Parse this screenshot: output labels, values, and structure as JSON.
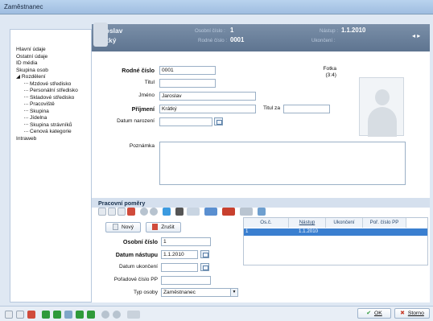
{
  "window": {
    "title": "Zaměstnanec"
  },
  "tree": {
    "items": [
      {
        "label": "Hlavní údaje",
        "child": false
      },
      {
        "label": "Ostatní údaje",
        "child": false
      },
      {
        "label": "ID média",
        "child": false
      },
      {
        "label": "Skupina osob",
        "child": false
      },
      {
        "label": "◢ Rozdělení",
        "child": false
      },
      {
        "label": "Mzdové středisko",
        "child": true
      },
      {
        "label": "Personální středisko",
        "child": true
      },
      {
        "label": "Skladové středisko",
        "child": true
      },
      {
        "label": "Pracoviště",
        "child": true
      },
      {
        "label": "Skupina",
        "child": true
      },
      {
        "label": "Jídelna",
        "child": true
      },
      {
        "label": "Skupina strávníků",
        "child": true
      },
      {
        "label": "Cenová kategorie",
        "child": true
      },
      {
        "label": "Intraweb",
        "child": false
      }
    ]
  },
  "header": {
    "first_name": "Jaroslav",
    "last_name": "Krátký",
    "osobni_cislo_label": "Osobní číslo :",
    "osobni_cislo": "1",
    "rodne_cislo_label": "Rodné číslo :",
    "rodne_cislo": "0001",
    "nastup_label": "Nástup :",
    "nastup": "1.1.2010",
    "ukonceni_label": "Ukončení :",
    "nav_icon": "play-arrow-icon"
  },
  "form": {
    "rodne_cislo_label": "Rodné číslo",
    "rodne_cislo_value": "0001",
    "titul_label": "Titul",
    "titul_value": "",
    "jmeno_label": "Jméno",
    "jmeno_value": "Jaroslav",
    "prijmeni_label": "Příjmení",
    "prijmeni_value": "Krátký",
    "titul_za_label": "Titul za",
    "titul_za_value": "",
    "datum_narozeni_label": "Datum narození",
    "datum_narozeni_value": "",
    "poznamka_label": "Poznámka",
    "poznamka_value": "",
    "fotka_label": "Fotka",
    "fotka_ratio": "(3:4)"
  },
  "pracovni": {
    "title": "Pracovní poměry",
    "novy_label": "Nový",
    "zrusit_label": "Zrušit",
    "osobni_cislo_label": "Osobní číslo",
    "osobni_cislo_value": "1",
    "datum_nastupu_label": "Datum nástupu",
    "datum_nastupu_value": "1.1.2010",
    "datum_ukonceni_label": "Datum ukončení",
    "datum_ukonceni_value": "",
    "poradove_label": "Pořadové číslo PP",
    "poradove_value": "",
    "typ_osoby_label": "Typ osoby",
    "typ_osoby_value": "Zaměstnanec",
    "grid_columns": [
      "Os.č.",
      "Nástup",
      "Ukončení",
      "Poř. číslo PP"
    ],
    "grid_row": [
      "1",
      "1.1.2010",
      "",
      ""
    ]
  },
  "footer": {
    "ok_label": "OK",
    "storno_label": "Storno"
  }
}
